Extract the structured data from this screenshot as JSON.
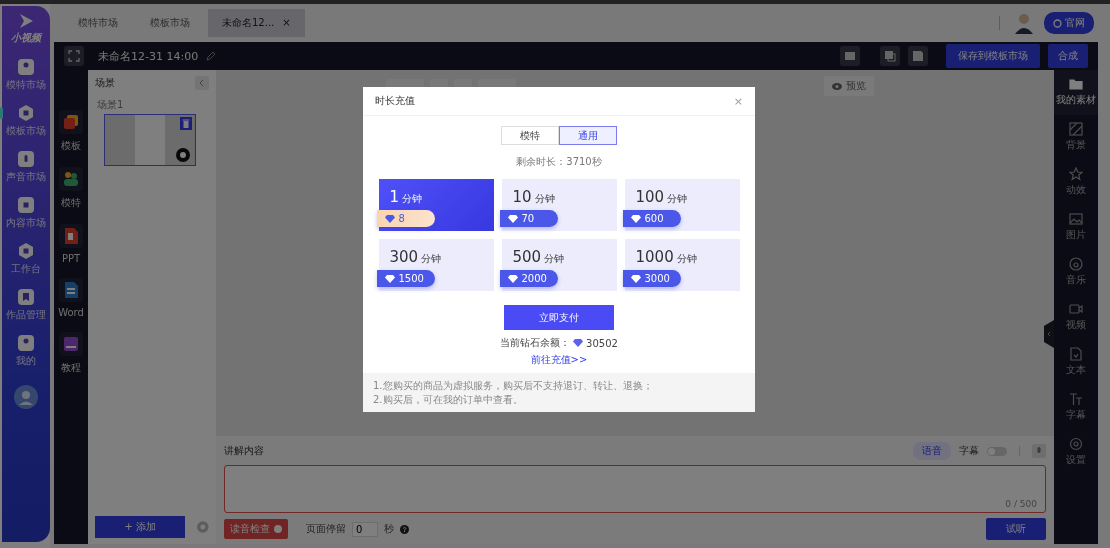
{
  "nav": {
    "logo": "小视频",
    "items": [
      {
        "label": "模特市场",
        "kind": "person",
        "selected": false
      },
      {
        "label": "模板市场",
        "kind": "hex",
        "selected": true
      },
      {
        "label": "声音市场",
        "kind": "mic",
        "selected": false
      },
      {
        "label": "内容市场",
        "kind": "box",
        "selected": false
      },
      {
        "label": "工作台",
        "kind": "hex",
        "selected": false
      },
      {
        "label": "作品管理",
        "kind": "bookmark",
        "selected": false
      },
      {
        "label": "我的",
        "kind": "person",
        "selected": false
      }
    ]
  },
  "tabs": [
    {
      "label": "模特市场",
      "selected": false
    },
    {
      "label": "模板市场",
      "selected": false
    },
    {
      "label": "未命名12...",
      "selected": true,
      "close": "×"
    }
  ],
  "site_button": "官网",
  "editor": {
    "title": "未命名12-31 14:00",
    "save_button": "保存到模板市场",
    "compose_button": "合成"
  },
  "tools": [
    {
      "label": "模板",
      "kind": "template"
    },
    {
      "label": "模特",
      "kind": "model"
    },
    {
      "label": "PPT",
      "kind": "ppt"
    },
    {
      "label": "Word",
      "kind": "word"
    },
    {
      "label": "教程",
      "kind": "tutorial"
    }
  ],
  "scenes": {
    "title": "场景",
    "items": [
      {
        "label": "场景1",
        "selected": true
      }
    ],
    "add_button": "+ 添加"
  },
  "preview_button": "预览",
  "rail": [
    {
      "label": "我的素材",
      "kind": "folder",
      "selected": true
    },
    {
      "label": "背景",
      "kind": "hatch",
      "selected": false
    },
    {
      "label": "动效",
      "kind": "star",
      "selected": false
    },
    {
      "label": "图片",
      "kind": "image",
      "selected": false
    },
    {
      "label": "音乐",
      "kind": "disc",
      "selected": false
    },
    {
      "label": "视频",
      "kind": "video",
      "selected": false
    },
    {
      "label": "文本",
      "kind": "file",
      "selected": false
    },
    {
      "label": "字幕",
      "kind": "text",
      "selected": false
    },
    {
      "label": "设置",
      "kind": "gear",
      "selected": false
    }
  ],
  "narration": {
    "title": "讲解内容",
    "voice_button": "语音",
    "subtitle_label": "字幕",
    "subtitle_on": false,
    "counter": "0 / 500",
    "check_button": "读音检查",
    "stay_label": "页面停留",
    "stay_value": "0",
    "stay_unit": "秒",
    "listen_button": "试听"
  },
  "dialog": {
    "title": "时长充值",
    "close": "×",
    "segments": [
      {
        "label": "模特",
        "selected": false
      },
      {
        "label": "通用",
        "selected": true
      }
    ],
    "remaining": "剩余时长：3710秒",
    "packages": [
      {
        "amount": "1",
        "unit": "分钟",
        "price": "8",
        "selected": true
      },
      {
        "amount": "10",
        "unit": "分钟",
        "price": "70",
        "selected": false
      },
      {
        "amount": "100",
        "unit": "分钟",
        "price": "600",
        "selected": false
      },
      {
        "amount": "300",
        "unit": "分钟",
        "price": "1500",
        "selected": false
      },
      {
        "amount": "500",
        "unit": "分钟",
        "price": "2000",
        "selected": false
      },
      {
        "amount": "1000",
        "unit": "分钟",
        "price": "3000",
        "selected": false
      }
    ],
    "pay_button": "立即支付",
    "balance_label": "当前钻石余额：",
    "balance": "30502",
    "recharge_link": "前往充值>>",
    "notes": [
      "1.您购买的商品为虚拟服务，购买后不支持退订、转让、退换；",
      "2.购买后，可在我的订单中查看。"
    ]
  }
}
